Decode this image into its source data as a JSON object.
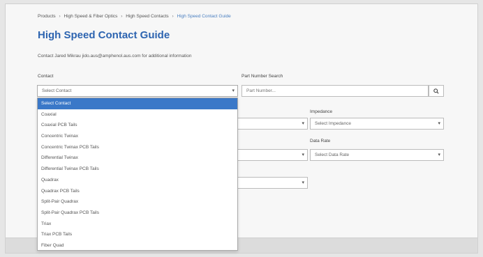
{
  "breadcrumb": {
    "items": [
      "Products",
      "High Speed & Fiber Optics",
      "High Speed Contacts"
    ],
    "current": "High Speed Contact Guide",
    "separator": "›"
  },
  "page": {
    "title": "High Speed Contact Guide",
    "contact_line": "Contact Jared Mikrau jido.aus@amphenol.aus.com for additional information"
  },
  "filters": {
    "contact_label": "Contact",
    "contact_value": "Select Contact",
    "part_search_label": "Part Number Search",
    "part_search_placeholder": "Part Number...",
    "impedance_label": "Impedance",
    "impedance_value": "Select Impedance",
    "data_rate_label": "Data Rate",
    "data_rate_value": "Select Data Rate"
  },
  "dropdown": {
    "options": [
      "Select Contact",
      "Coaxial",
      "Coaxial PCB Tails",
      "Concentric Twinax",
      "Concentric Twinax PCB Tails",
      "Differential Twinax",
      "Differential Twinax PCB Tails",
      "Quadrax",
      "Quadrax PCB Tails",
      "Split-Pair Quadrax",
      "Split-Pair Quadrax PCB Tails",
      "Triax",
      "Triax PCB Tails",
      "Fiber Quad"
    ],
    "selected_index": 0
  },
  "icons": {
    "dropdown_arrow": "chevron-down-icon",
    "search": "search-icon"
  },
  "colors": {
    "title": "#2d64b0",
    "selected_option": "#3a78c8",
    "breadcrumb_current": "#4a7fc0"
  }
}
